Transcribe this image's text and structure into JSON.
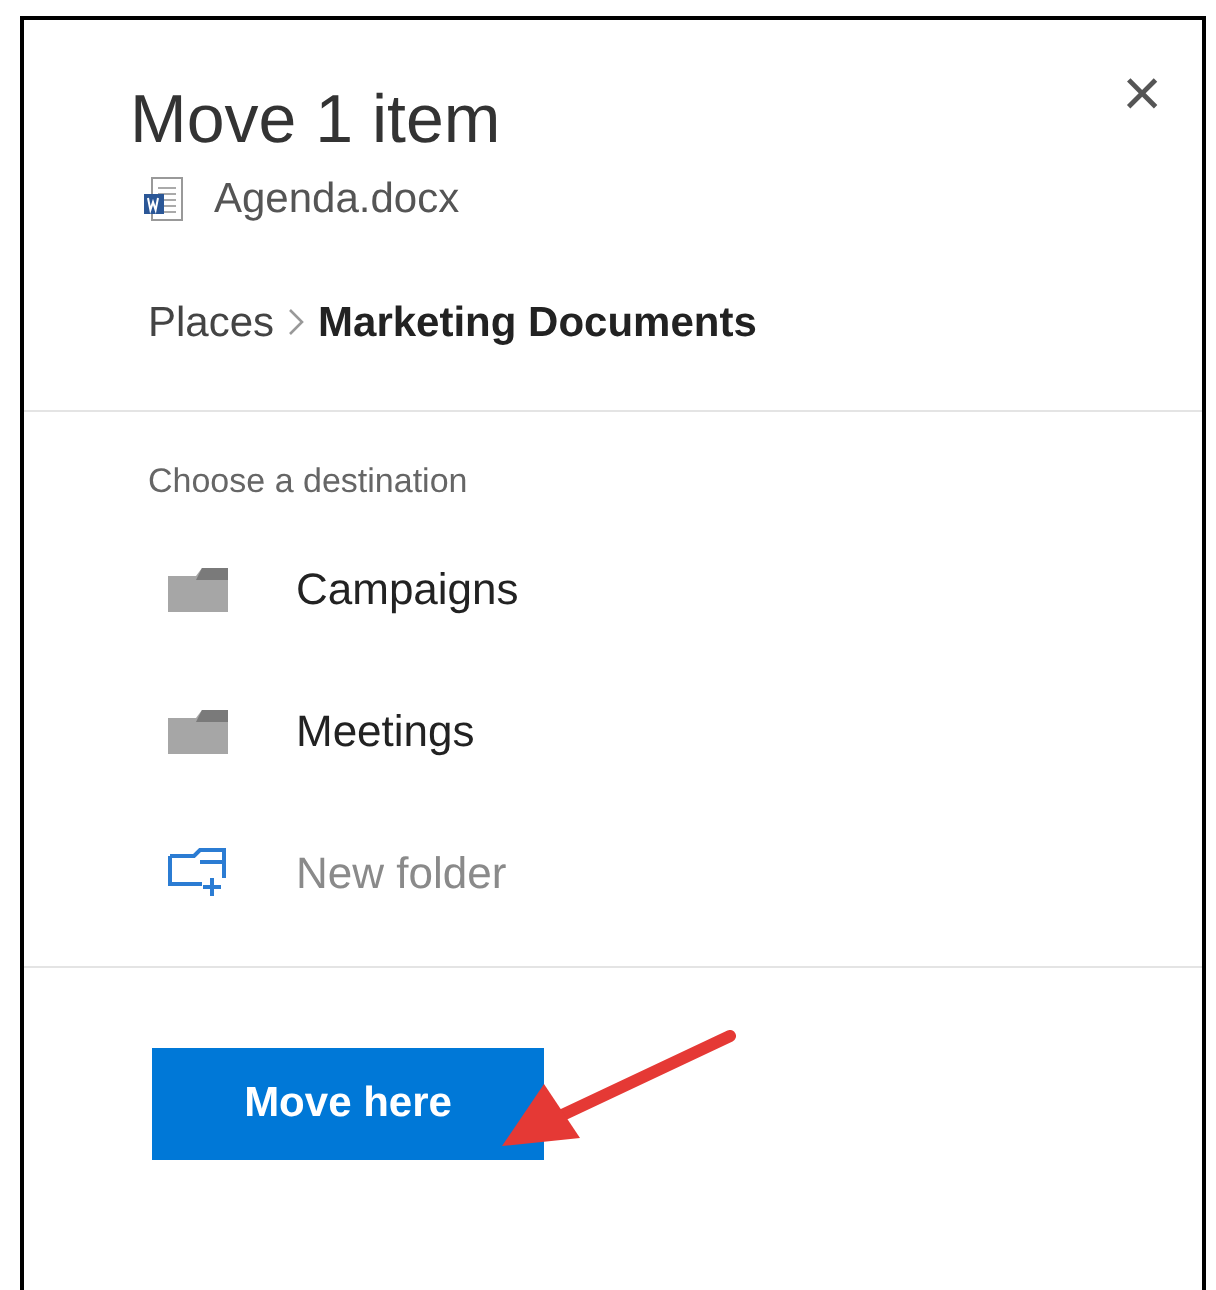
{
  "panel": {
    "title": "Move 1 item",
    "file_name": "Agenda.docx",
    "close_glyph": "×"
  },
  "breadcrumb": [
    "Places",
    "Marketing Documents"
  ],
  "destination": {
    "heading": "Choose a destination",
    "items": [
      {
        "kind": "folder",
        "label": "Campaigns"
      },
      {
        "kind": "folder",
        "label": "Meetings"
      },
      {
        "kind": "new-folder",
        "label": "New folder"
      }
    ]
  },
  "button": {
    "label": "Move here"
  }
}
